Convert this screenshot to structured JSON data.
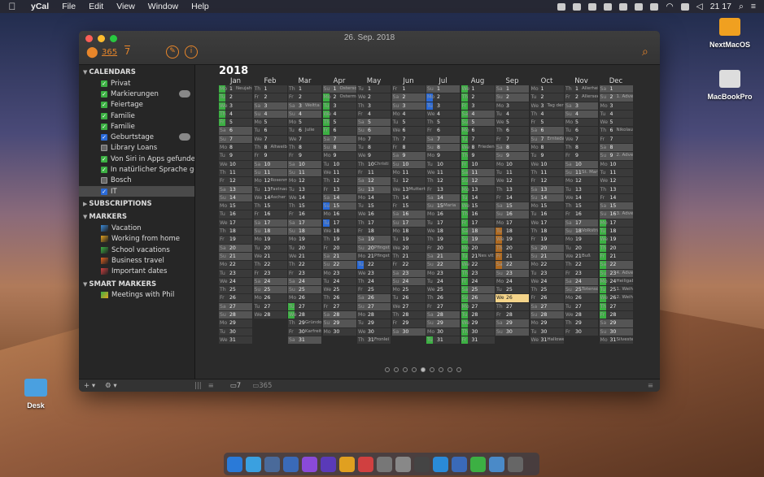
{
  "menubar": {
    "apple": "",
    "app": "yCal",
    "items": [
      "File",
      "Edit",
      "View",
      "Window",
      "Help"
    ],
    "clock": "21 17"
  },
  "desktop": {
    "icons": [
      {
        "label": "NextMacOS"
      },
      {
        "label": "MacBookPro"
      },
      {
        "label": "Desk"
      }
    ]
  },
  "window": {
    "title": "26. Sep. 2018",
    "toolbar": {
      "days365": "365",
      "days7": "7"
    }
  },
  "sidebar": {
    "calendars_title": "CALENDARS",
    "calendars": [
      {
        "label": "Privat",
        "color": "#3cb043"
      },
      {
        "label": "Markierungen",
        "color": "#3cb043"
      },
      {
        "label": "Feiertage",
        "color": "#3cb043"
      },
      {
        "label": "Familie",
        "color": "#3cb043"
      },
      {
        "label": "Familie",
        "color": "#3cb043"
      },
      {
        "label": "Geburtstage",
        "color": "#2a6ad8"
      },
      {
        "label": "Library Loans",
        "color": ""
      },
      {
        "label": "Von Siri in Apps gefunden",
        "color": "#3cb043"
      },
      {
        "label": "In natürlicher Sprache ge...",
        "color": "#3cb043"
      },
      {
        "label": "Bosch",
        "color": ""
      },
      {
        "label": "IT",
        "color": "#2a6ad8"
      }
    ],
    "subscriptions_title": "SUBSCRIPTIONS",
    "markers_title": "MARKERS",
    "markers": [
      "Vacation",
      "Working from home",
      "School vacations",
      "Business travel",
      "Important dates"
    ],
    "smart_title": "SMART MARKERS",
    "smart": [
      "Meetings with Phil"
    ]
  },
  "calendar": {
    "year": "2018",
    "months": [
      {
        "name": "Jan",
        "start": 0,
        "days": 31
      },
      {
        "name": "Feb",
        "start": 3,
        "days": 28
      },
      {
        "name": "Mar",
        "start": 3,
        "days": 31
      },
      {
        "name": "Apr",
        "start": 6,
        "days": 30
      },
      {
        "name": "May",
        "start": 1,
        "days": 31
      },
      {
        "name": "Jun",
        "start": 4,
        "days": 30
      },
      {
        "name": "Jul",
        "start": 6,
        "days": 31
      },
      {
        "name": "Aug",
        "start": 2,
        "days": 31
      },
      {
        "name": "Sep",
        "start": 5,
        "days": 30
      },
      {
        "name": "Oct",
        "start": 0,
        "days": 31
      },
      {
        "name": "Nov",
        "start": 3,
        "days": 30
      },
      {
        "name": "Dec",
        "start": 5,
        "days": 31
      }
    ],
    "weekdays": [
      "Mo",
      "Tu",
      "We",
      "Th",
      "Fr",
      "Sa",
      "Su"
    ],
    "today": {
      "month": 8,
      "day": 26
    },
    "events": {
      "0-1": "Neujahr",
      "1-8": "Altweib",
      "1-12": "Rosenm",
      "1-13": "Fastnac",
      "1-14": "Ascher",
      "2-3": "Weltta",
      "2-6": "Julie",
      "2-29": "Gründon",
      "2-30": "Karfreit",
      "3-1": "Ostersonntag",
      "3-2": "Ostermontag",
      "4-10": "Christi",
      "4-20": "Pfingst",
      "4-21": "Pfingst",
      "4-31": "Fronlei",
      "5-13": "Muttert",
      "6-15": "Maria",
      "7-8": "Friedensf",
      "7-21": "Nes vit",
      "9-3": "Tag der",
      "9-7": "Erntedan",
      "9-31": "Hallowe",
      "10-1": "Allerheil",
      "10-2": "Allersee",
      "10-11": "St. Mart",
      "10-18": "Volkstrau",
      "10-21": "Buß",
      "10-25": "Totensonn",
      "11-2": "1. Advent",
      "11-6": "Nikolau",
      "11-9": "2. Advent",
      "11-16": "3. Advent",
      "11-23": "4. Advent",
      "11-24": "Heiligab",
      "11-25": "1. Weih",
      "11-26": "2. Weih",
      "11-31": "Silvester"
    },
    "green": {
      "0": [
        1,
        2,
        3,
        4,
        5
      ],
      "2": [
        27,
        28
      ],
      "3": [
        2,
        3,
        4,
        5,
        6
      ],
      "6": [
        31
      ],
      "7": [
        1,
        2,
        3,
        4,
        5,
        6,
        7,
        8,
        9,
        10,
        11,
        12,
        13,
        14,
        15,
        16,
        17,
        18,
        19,
        20,
        21,
        22,
        23,
        24,
        25,
        26,
        27,
        28,
        29,
        30,
        31
      ],
      "11": [
        17,
        18,
        19,
        20,
        21,
        22,
        23,
        24,
        25,
        26,
        27,
        28
      ]
    },
    "blue": {
      "6": [
        2,
        3
      ],
      "3": [
        15,
        17
      ],
      "4": [
        22
      ]
    },
    "orange": {
      "8": [
        18,
        19,
        20,
        21,
        22
      ]
    }
  },
  "bottombar": {
    "add": "+ ▾",
    "gear": "⚙ ▾",
    "week_label": "7",
    "year_label": "365"
  },
  "pager": {
    "count": 9,
    "active": 4
  }
}
